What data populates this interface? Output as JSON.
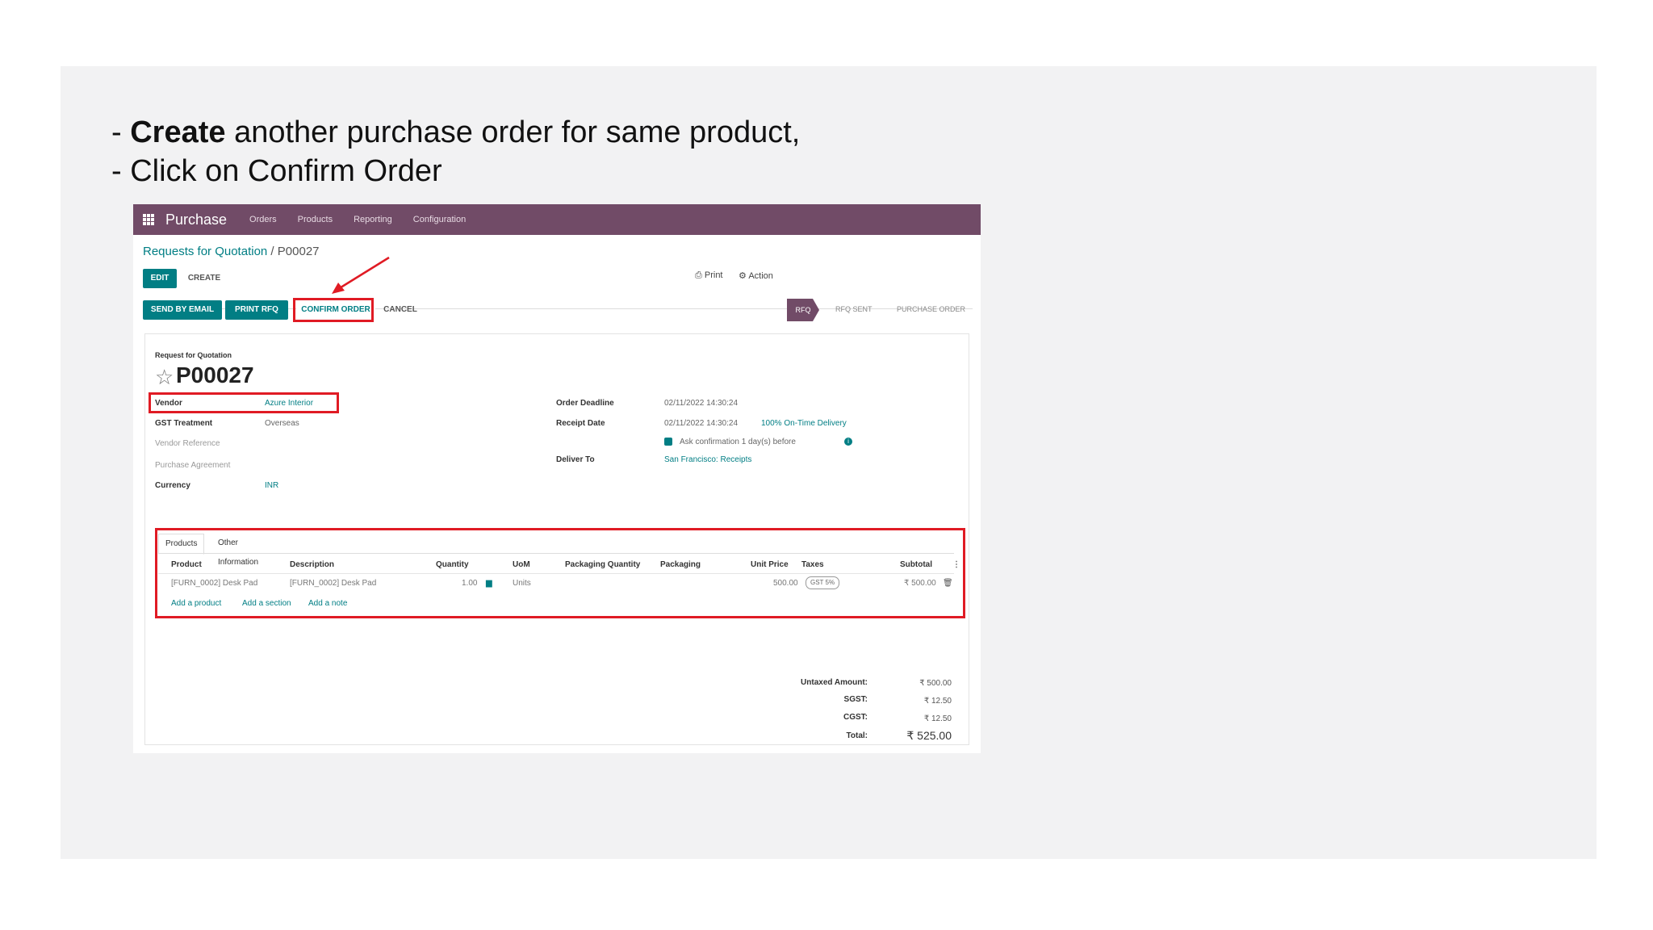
{
  "instructions": {
    "line1_prefix": "- ",
    "line1_bold": "Create",
    "line1_rest": " another purchase order for same product,",
    "line2": "- Click on Confirm Order"
  },
  "topbar": {
    "app_name": "Purchase",
    "menu": [
      "Orders",
      "Products",
      "Reporting",
      "Configuration"
    ]
  },
  "breadcrumb": {
    "parent": "Requests for Quotation",
    "separator": " / ",
    "current": "P00027"
  },
  "toolbar": {
    "edit": "EDIT",
    "create": "CREATE",
    "print": "Print",
    "action": "Action"
  },
  "actions": {
    "send_by_email": "SEND BY EMAIL",
    "print_rfq": "PRINT RFQ",
    "confirm_order": "CONFIRM ORDER",
    "cancel": "CANCEL"
  },
  "status": {
    "steps": [
      "RFQ",
      "RFQ SENT",
      "PURCHASE ORDER"
    ],
    "active": "RFQ"
  },
  "form": {
    "doc_type": "Request for Quotation",
    "doc_number": "P00027",
    "vendor_label": "Vendor",
    "vendor_value": "Azure Interior",
    "gst_label": "GST Treatment",
    "gst_value": "Overseas",
    "vendor_ref_label": "Vendor Reference",
    "agreement_label": "Purchase Agreement",
    "currency_label": "Currency",
    "currency_value": "INR",
    "deadline_label": "Order Deadline",
    "deadline_value": "02/11/2022 14:30:24",
    "receipt_label": "Receipt Date",
    "receipt_value": "02/11/2022 14:30:24",
    "on_time": "100% On-Time Delivery",
    "ask_confirmation": "Ask confirmation 1 day(s) before",
    "deliver_label": "Deliver To",
    "deliver_value": "San Francisco: Receipts"
  },
  "lines": {
    "tabs": [
      "Products",
      "Other Information"
    ],
    "headers": [
      "Product",
      "Description",
      "Quantity",
      "UoM",
      "Packaging Quantity",
      "Packaging",
      "Unit Price",
      "Taxes",
      "Subtotal"
    ],
    "row": {
      "product": "[FURN_0002] Desk Pad",
      "description": "[FURN_0002] Desk Pad",
      "quantity": "1.00",
      "uom": "Units",
      "unit_price": "500.00",
      "taxes": "GST 5%",
      "subtotal": "₹ 500.00"
    },
    "add_product": "Add a product",
    "add_section": "Add a section",
    "add_note": "Add a note"
  },
  "totals": {
    "untaxed_label": "Untaxed Amount:",
    "untaxed_value": "₹ 500.00",
    "sgst_label": "SGST:",
    "sgst_value": "₹ 12.50",
    "cgst_label": "CGST:",
    "cgst_value": "₹ 12.50",
    "total_label": "Total:",
    "total_value": "₹ 525.00"
  },
  "colors": {
    "brand": "#714b67",
    "primary": "#017e84",
    "highlight": "#e01b24"
  }
}
